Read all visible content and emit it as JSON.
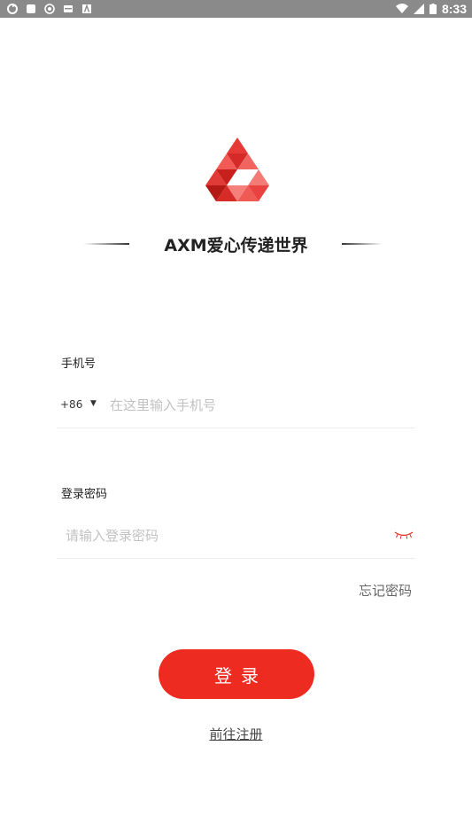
{
  "status_bar": {
    "time": "8:33"
  },
  "brand": {
    "title": "AXM爱心传递世界",
    "accent_color": "#ee2b20"
  },
  "form": {
    "phone": {
      "label": "手机号",
      "country_code": "+86",
      "caret": "▼",
      "placeholder": "在这里输入手机号",
      "value": ""
    },
    "password": {
      "label": "登录密码",
      "placeholder": "请输入登录密码",
      "value": "",
      "toggle_icon": "eye-closed-icon"
    },
    "forgot_label": "忘记密码",
    "login_label": "登录",
    "register_label": "前往注册"
  }
}
